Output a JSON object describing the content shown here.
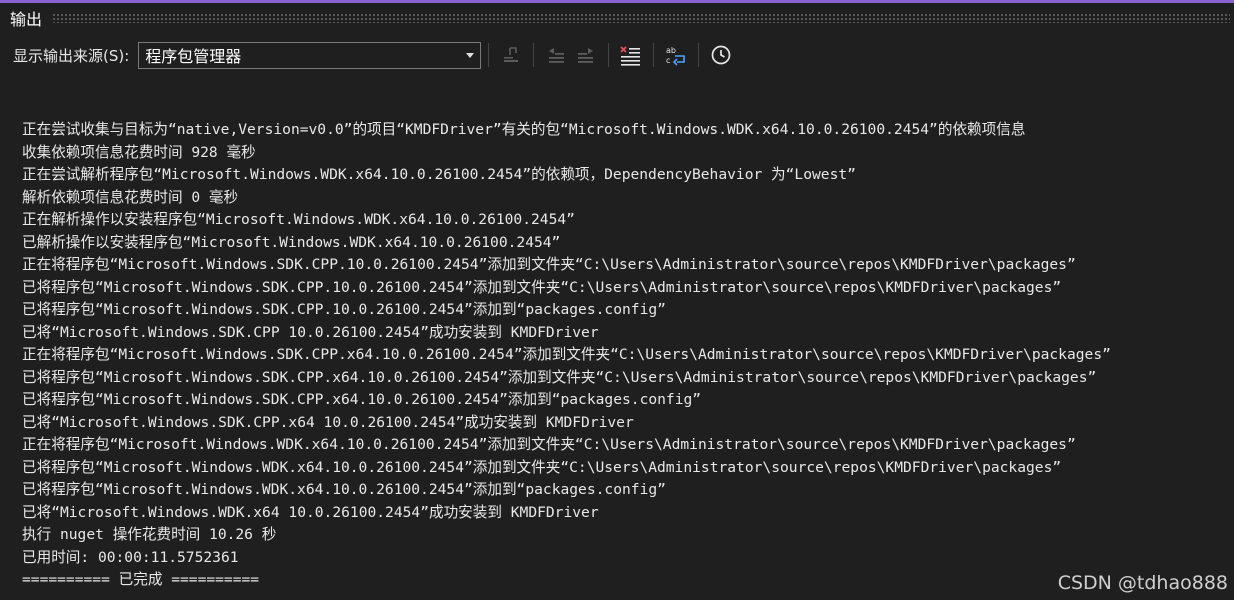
{
  "panel": {
    "title": "输出"
  },
  "toolbar": {
    "source_label": "显示输出来源(S):",
    "source_value": "程序包管理器",
    "icons": [
      "go-to-source-icon",
      "previous-message-icon",
      "next-message-icon",
      "clear-all-icon",
      "word-wrap-icon",
      "timestamp-clock-icon"
    ]
  },
  "output": {
    "lines": [
      "正在尝试收集与目标为“native,Version=v0.0”的项目“KMDFDriver”有关的包“Microsoft.Windows.WDK.x64.10.0.26100.2454”的依赖项信息",
      "收集依赖项信息花费时间 928 毫秒",
      "正在尝试解析程序包“Microsoft.Windows.WDK.x64.10.0.26100.2454”的依赖项，DependencyBehavior 为“Lowest”",
      "解析依赖项信息花费时间 0 毫秒",
      "正在解析操作以安装程序包“Microsoft.Windows.WDK.x64.10.0.26100.2454”",
      "已解析操作以安装程序包“Microsoft.Windows.WDK.x64.10.0.26100.2454”",
      "正在将程序包“Microsoft.Windows.SDK.CPP.10.0.26100.2454”添加到文件夹“C:\\Users\\Administrator\\source\\repos\\KMDFDriver\\packages”",
      "已将程序包“Microsoft.Windows.SDK.CPP.10.0.26100.2454”添加到文件夹“C:\\Users\\Administrator\\source\\repos\\KMDFDriver\\packages”",
      "已将程序包“Microsoft.Windows.SDK.CPP.10.0.26100.2454”添加到“packages.config”",
      "已将“Microsoft.Windows.SDK.CPP 10.0.26100.2454”成功安装到 KMDFDriver",
      "正在将程序包“Microsoft.Windows.SDK.CPP.x64.10.0.26100.2454”添加到文件夹“C:\\Users\\Administrator\\source\\repos\\KMDFDriver\\packages”",
      "已将程序包“Microsoft.Windows.SDK.CPP.x64.10.0.26100.2454”添加到文件夹“C:\\Users\\Administrator\\source\\repos\\KMDFDriver\\packages”",
      "已将程序包“Microsoft.Windows.SDK.CPP.x64.10.0.26100.2454”添加到“packages.config”",
      "已将“Microsoft.Windows.SDK.CPP.x64 10.0.26100.2454”成功安装到 KMDFDriver",
      "正在将程序包“Microsoft.Windows.WDK.x64.10.0.26100.2454”添加到文件夹“C:\\Users\\Administrator\\source\\repos\\KMDFDriver\\packages”",
      "已将程序包“Microsoft.Windows.WDK.x64.10.0.26100.2454”添加到文件夹“C:\\Users\\Administrator\\source\\repos\\KMDFDriver\\packages”",
      "已将程序包“Microsoft.Windows.WDK.x64.10.0.26100.2454”添加到“packages.config”",
      "已将“Microsoft.Windows.WDK.x64 10.0.26100.2454”成功安装到 KMDFDriver",
      "执行 nuget 操作花费时间 10.26 秒",
      "已用时间: 00:00:11.5752361",
      "========== 已完成 =========="
    ]
  },
  "watermark": "CSDN @tdhao888",
  "colors": {
    "background": "#1f1f1f",
    "accent": "#8a63d2",
    "text": "#e8e8e8",
    "clear_icon_red": "#e05555",
    "wrap_icon_blue": "#4aa3ff"
  }
}
